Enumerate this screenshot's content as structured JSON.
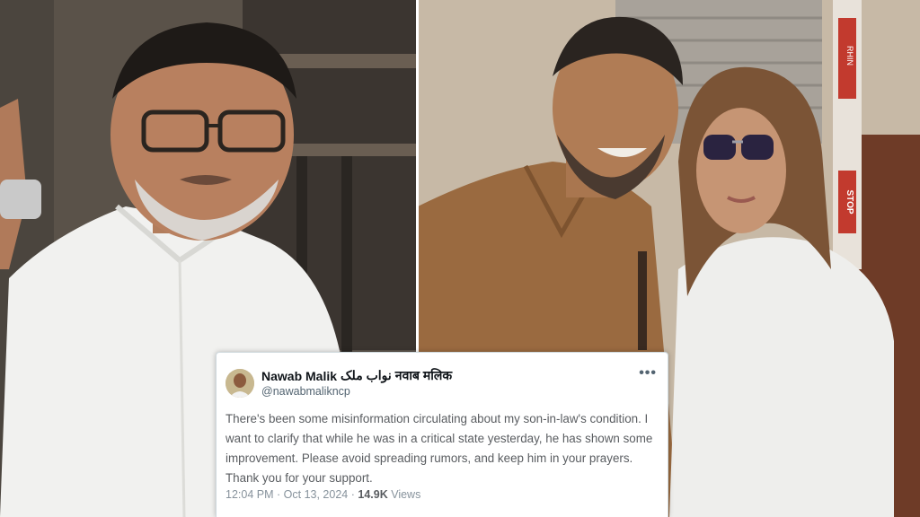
{
  "tweet": {
    "author_name": "Nawab Malik",
    "author_name_urdu": "نواب ملک",
    "author_name_hindi": "नवाब मलिक",
    "handle": "@nawabmalikncp",
    "more_icon": "more-horizontal-icon",
    "text": "There's been some misinformation circulating about my son-in-law's condition. I want to clarify that while he was in a critical state yesterday, he has shown some improvement. Please avoid spreading rumors, and keep him in your prayers. Thank you for your support.",
    "time": "12:04 PM",
    "separator": "·",
    "date": "Oct 13, 2024",
    "views_count": "14.9K",
    "views_label": "Views"
  },
  "photo_right": {
    "sign_text_top": "RHIN",
    "sign_text_bottom": "STOP"
  }
}
